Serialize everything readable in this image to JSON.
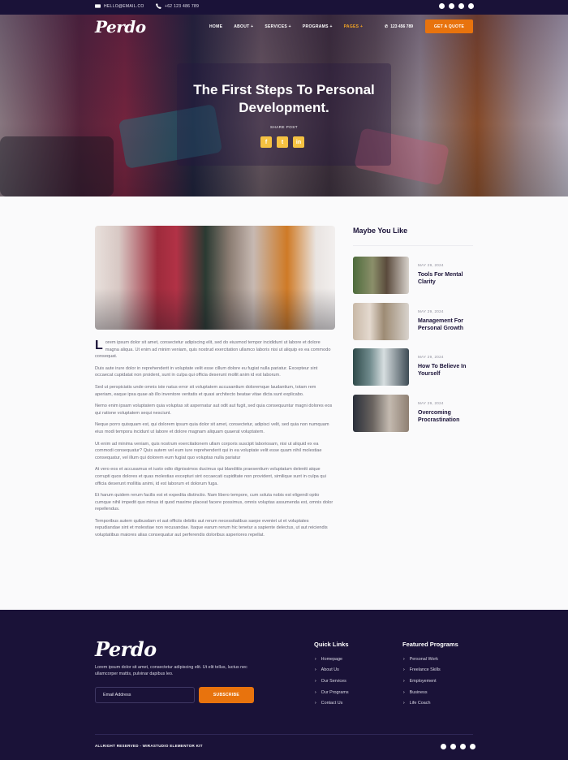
{
  "topbar": {
    "email": "HELLO@EMAIL.CO",
    "phone": "+62 123 486 789"
  },
  "brand": {
    "logo": "Perdo"
  },
  "nav": {
    "items": [
      "HOME",
      "ABOUT +",
      "SERVICES +",
      "PROGRAMS +",
      "PAGES +"
    ],
    "phone": "123 456 789",
    "cta": "GET A QUOTE"
  },
  "hero": {
    "title": "The First Steps To Personal Development.",
    "share_label": "SHARE POST",
    "share_icons": [
      "facebook-icon",
      "twitter-icon",
      "linkedin-icon"
    ],
    "share_glyphs": [
      "f",
      "t",
      "in"
    ]
  },
  "article": {
    "dropcap": "L",
    "first": "orem ipsum dolor sit amet, consectetur adipiscing elit, sed do eiusmod tempor incididunt ut labore et dolore magna aliqua. Ut enim ad minim veniam, quis nostrud exercitation ullamco laboris nisi ut aliquip ex ea commodo consequat.",
    "paragraphs": [
      "Duis aute irure dolor in reprehenderit in voluptate velit esse cillum dolore eu fugiat nulla pariatur. Excepteur sint occaecat cupidatat non proident, sunt in culpa qui officia deserunt mollit anim id est laborum.",
      "Sed ut perspiciatis unde omnis iste natus error sit voluptatem accusantium doloremque laudantium, totam rem aperiam, eaque ipsa quae ab illo inventore veritatis et quasi architecto beatae vitae dicta sunt explicabo.",
      "Nemo enim ipsam voluptatem quia voluptas sit aspernatur aut odit aut fugit, sed quia consequuntur magni dolores eos qui ratione voluptatem sequi nesciunt.",
      "Neque porro quisquam est, qui dolorem ipsum quia dolor sit amet, consectetur, adipisci velit, sed quia non numquam eius modi tempora incidunt ut labore et dolore magnam aliquam quaerat voluptatem.",
      "Ut enim ad minima veniam, quis nostrum exercitationem ullam corporis suscipit laboriosam, nisi ut aliquid ex ea commodi consequatur? Quis autem vel eum iure reprehenderit qui in ea voluptate velit esse quam nihil molestiae consequatur, vel illum qui dolorem eum fugiat quo voluptas nulla pariatur",
      "At vero eos et accusamus et iusto odio dignissimos ducimus qui blanditiis praesentium voluptatum deleniti atque corrupti quos dolores et quas molestias excepturi sint occaecati cupiditate non provident, similique sunt in culpa qui officia deserunt mollitia animi, id est laborum et dolorum fuga.",
      "Et harum quidem rerum facilis est et expedita distinctio. Nam libero tempore, cum soluta nobis est eligendi optio cumque nihil impedit quo minus id quod maxime placeat facere possimus, omnis voluptas assumenda est, omnis dolor repellendus.",
      "Temporibus autem quibusdam et aut officiis debitis aut rerum necessitatibus saepe eveniet ut et voluptates repudiandae sint et molestiae non recusandae. Itaque earum rerum hic tenetur a sapiente delectus, ut aut reiciendis voluptatibus maiores alias consequatur aut perferendis doloribus asperiores repellat."
    ]
  },
  "sidebar": {
    "title": "Maybe You Like",
    "posts": [
      {
        "date": "MAY 29, 2024",
        "title": "Tools For Mental Clarity"
      },
      {
        "date": "MAY 29, 2024",
        "title": "Management For Personal Growth"
      },
      {
        "date": "MAY 29, 2024",
        "title": "How To Believe In Yourself"
      },
      {
        "date": "MAY 29, 2024",
        "title": "Overcoming Procrastination"
      }
    ]
  },
  "footer": {
    "description": "Lorem ipsum dolor sit amet, consectetur adipiscing elit. Ut elit tellus, luctus nec ullamcorper mattis, pulvinar dapibus leo.",
    "email_placeholder": "Email Address",
    "subscribe": "SUBSCRIBE",
    "quick_links_title": "Quick Links",
    "quick_links": [
      "Homepage",
      "About Us",
      "Our Services",
      "Our Programs",
      "Contact Us"
    ],
    "programs_title": "Featured Programs",
    "programs": [
      "Personal Work",
      "Freelance Skills",
      "Employement",
      "Business",
      "Life Coach"
    ],
    "copyright": "ALLRIGHT RESERVED - WIRASTUDIO ELEMENTOR KIT"
  },
  "colors": {
    "accent": "#e8730d",
    "brand_dark": "#1a1238",
    "highlight": "#f5c242"
  }
}
